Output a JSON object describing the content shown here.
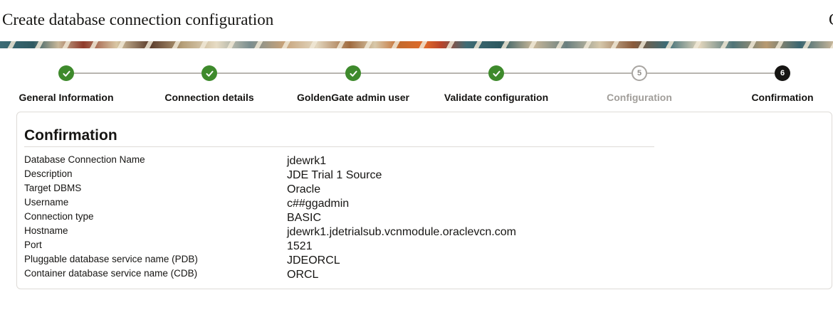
{
  "header": {
    "title": "Create database connection configuration",
    "title_cutoff": "C"
  },
  "stepper": {
    "steps": [
      {
        "number": "1",
        "label": "General Information",
        "state": "done"
      },
      {
        "number": "2",
        "label": "Connection details",
        "state": "done"
      },
      {
        "number": "3",
        "label": "GoldenGate admin user",
        "state": "done"
      },
      {
        "number": "4",
        "label": "Validate configuration",
        "state": "done"
      },
      {
        "number": "5",
        "label": "Configuration",
        "state": "pending"
      },
      {
        "number": "6",
        "label": "Confirmation",
        "state": "current"
      }
    ],
    "colors": {
      "done": "#3e8a2c",
      "current": "#161513",
      "pending": "#a8a5a1"
    }
  },
  "confirmation": {
    "title": "Confirmation",
    "rows": [
      {
        "label": "Database Connection Name",
        "value": "jdewrk1"
      },
      {
        "label": "Description",
        "value": "JDE Trial 1 Source"
      },
      {
        "label": "Target DBMS",
        "value": "Oracle"
      },
      {
        "label": "Username",
        "value": "c##ggadmin"
      },
      {
        "label": "Connection type",
        "value": "BASIC"
      },
      {
        "label": "Hostname",
        "value": "jdewrk1.jdetrialsub.vcnmodule.oraclevcn.com"
      },
      {
        "label": "Port",
        "value": "1521"
      },
      {
        "label": "Pluggable database service name (PDB)",
        "value": "JDEORCL"
      },
      {
        "label": "Container database service name (CDB)",
        "value": "ORCL"
      }
    ]
  }
}
